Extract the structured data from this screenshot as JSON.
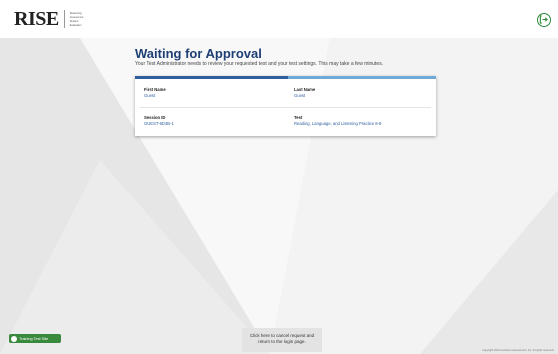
{
  "header": {
    "logo_text": "RISE",
    "logo_sub": [
      "Reasoning",
      "Assessment",
      "Student",
      "Evaluation"
    ],
    "logout_icon": "logout-icon"
  },
  "page": {
    "title": "Waiting for Approval",
    "subtitle": "Your Test Administrator needs to review your requested test and your test settings. This may take a few minutes."
  },
  "card": {
    "first_name_label": "First Name",
    "first_name_value": "Guest",
    "last_name_label": "Last Name",
    "last_name_value": "Guest",
    "session_id_label": "Session ID",
    "session_id_value": "GUEST-6D4B-1",
    "test_label": "Test",
    "test_value": "Reading, Language, and Listening Practice 8-9"
  },
  "bottom_button": {
    "line1": "Click here to cancel request and",
    "line2": "return to the login page."
  },
  "badge": {
    "label": "Training Test Site"
  },
  "footer_note": "Copyright 2024 Cambium Assessment, Inc. All rights reserved.",
  "colors": {
    "title": "#1d3f73",
    "card_bar_left": "#2d5fa0",
    "card_bar_right": "#6fa9d8",
    "badge": "#3a8a3e",
    "logout": "#2e8b3a"
  }
}
